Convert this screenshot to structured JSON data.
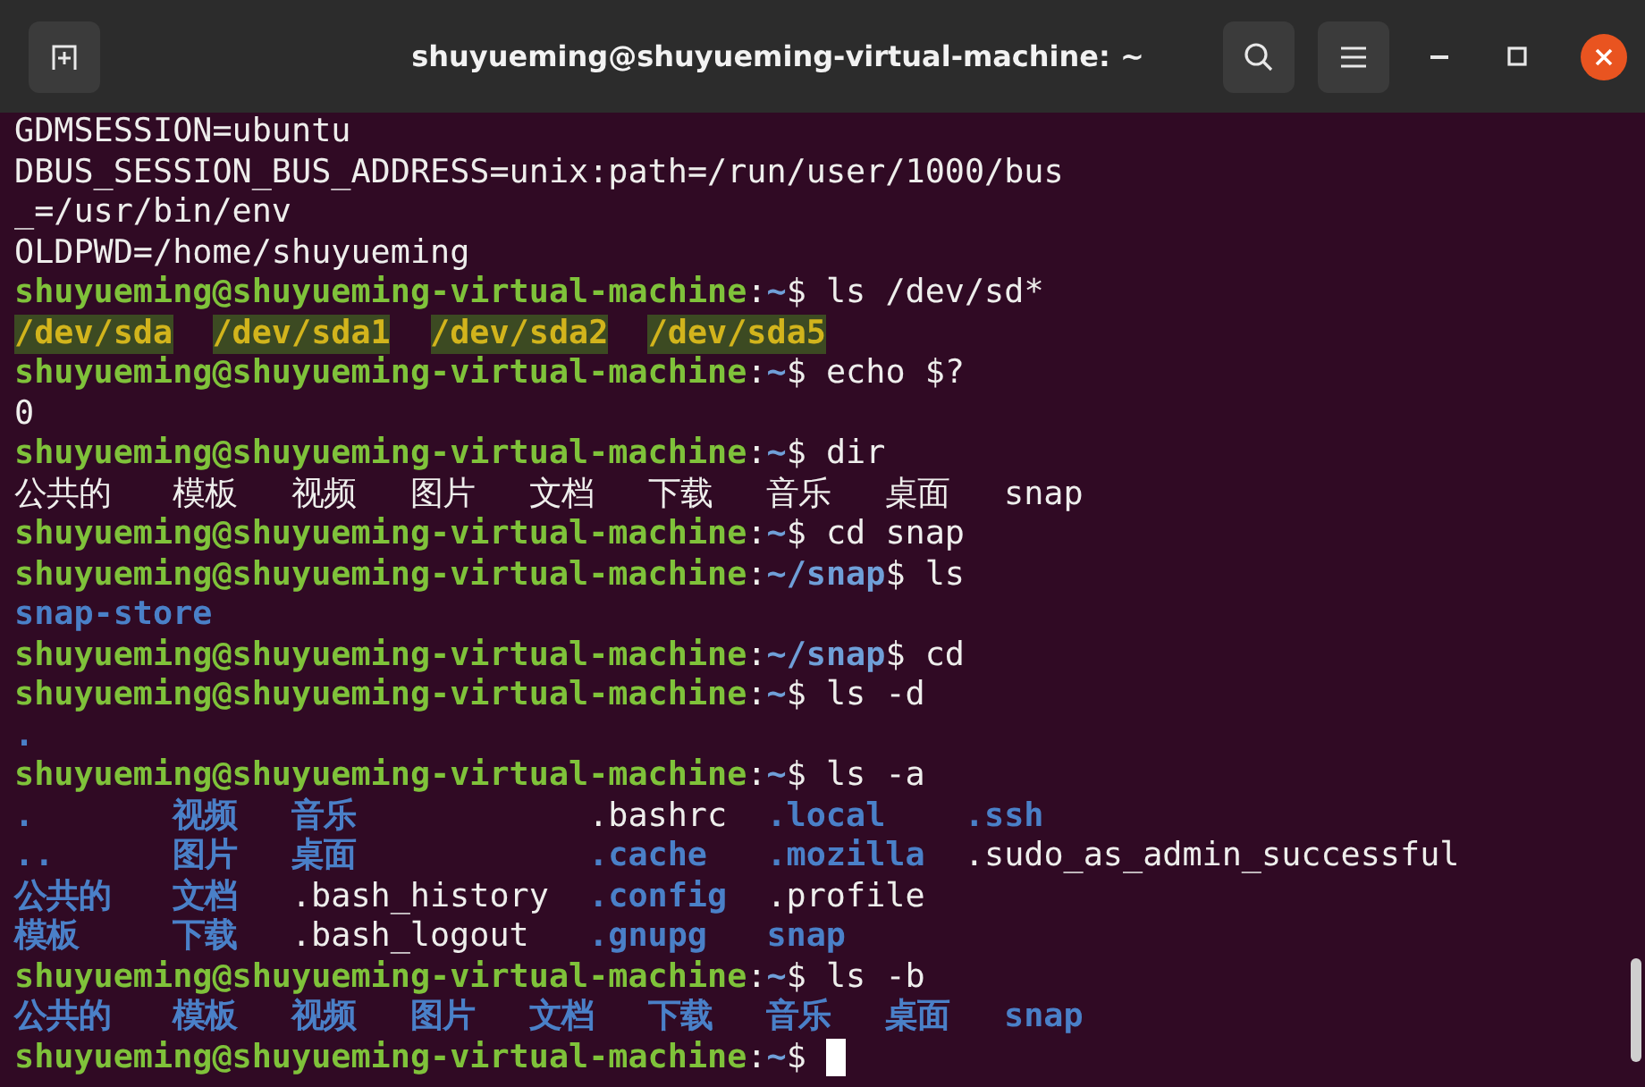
{
  "window": {
    "title": "shuyueming@shuyueming-virtual-machine: ~"
  },
  "terminal": {
    "lines": [
      {
        "kind": "seq",
        "segments": [
          {
            "text": "GDMSESSION=ubuntu",
            "kind": "plain"
          }
        ]
      },
      {
        "kind": "seq",
        "segments": [
          {
            "text": "DBUS_SESSION_BUS_ADDRESS=unix:path=/run/user/1000/bus",
            "kind": "plain"
          }
        ]
      },
      {
        "kind": "seq",
        "segments": [
          {
            "text": "_=/usr/bin/env",
            "kind": "plain"
          }
        ]
      },
      {
        "kind": "seq",
        "segments": [
          {
            "text": "OLDPWD=/home/shuyueming",
            "kind": "plain"
          }
        ]
      },
      {
        "kind": "seq",
        "segments": [
          {
            "text": "shuyueming@shuyueming-virtual-machine",
            "kind": "user"
          },
          {
            "text": ":",
            "kind": "plain"
          },
          {
            "text": "~",
            "kind": "path"
          },
          {
            "text": "$ ls /dev/sd*",
            "kind": "plain"
          }
        ]
      },
      {
        "kind": "list",
        "items": [
          {
            "text": "/dev/sda",
            "kind": "device"
          },
          {
            "text": "/dev/sda1",
            "kind": "device"
          },
          {
            "text": "/dev/sda2",
            "kind": "device"
          },
          {
            "text": "/dev/sda5",
            "kind": "device"
          }
        ]
      },
      {
        "kind": "seq",
        "segments": [
          {
            "text": "shuyueming@shuyueming-virtual-machine",
            "kind": "user"
          },
          {
            "text": ":",
            "kind": "plain"
          },
          {
            "text": "~",
            "kind": "path"
          },
          {
            "text": "$ echo $?",
            "kind": "plain"
          }
        ]
      },
      {
        "kind": "seq",
        "segments": [
          {
            "text": "0",
            "kind": "plain"
          }
        ]
      },
      {
        "kind": "seq",
        "segments": [
          {
            "text": "shuyueming@shuyueming-virtual-machine",
            "kind": "user"
          },
          {
            "text": ":",
            "kind": "plain"
          },
          {
            "text": "~",
            "kind": "path"
          },
          {
            "text": "$ dir",
            "kind": "plain"
          }
        ]
      },
      {
        "kind": "list",
        "items": [
          {
            "text": "公共的",
            "kind": "plain"
          },
          {
            "text": "模板",
            "kind": "plain"
          },
          {
            "text": "视频",
            "kind": "plain"
          },
          {
            "text": "图片",
            "kind": "plain"
          },
          {
            "text": "文档",
            "kind": "plain"
          },
          {
            "text": "下载",
            "kind": "plain"
          },
          {
            "text": "音乐",
            "kind": "plain"
          },
          {
            "text": "桌面",
            "kind": "plain"
          },
          {
            "text": "snap",
            "kind": "plain"
          }
        ]
      },
      {
        "kind": "seq",
        "segments": [
          {
            "text": "shuyueming@shuyueming-virtual-machine",
            "kind": "user"
          },
          {
            "text": ":",
            "kind": "plain"
          },
          {
            "text": "~",
            "kind": "path"
          },
          {
            "text": "$ cd snap",
            "kind": "plain"
          }
        ]
      },
      {
        "kind": "seq",
        "segments": [
          {
            "text": "shuyueming@shuyueming-virtual-machine",
            "kind": "user"
          },
          {
            "text": ":",
            "kind": "plain"
          },
          {
            "text": "~/snap",
            "kind": "path"
          },
          {
            "text": "$ ls",
            "kind": "plain"
          }
        ]
      },
      {
        "kind": "list",
        "items": [
          {
            "text": "snap-store",
            "kind": "dir"
          }
        ]
      },
      {
        "kind": "seq",
        "segments": [
          {
            "text": "shuyueming@shuyueming-virtual-machine",
            "kind": "user"
          },
          {
            "text": ":",
            "kind": "plain"
          },
          {
            "text": "~/snap",
            "kind": "path"
          },
          {
            "text": "$ cd",
            "kind": "plain"
          }
        ]
      },
      {
        "kind": "seq",
        "segments": [
          {
            "text": "shuyueming@shuyueming-virtual-machine",
            "kind": "user"
          },
          {
            "text": ":",
            "kind": "plain"
          },
          {
            "text": "~",
            "kind": "path"
          },
          {
            "text": "$ ls -d",
            "kind": "plain"
          }
        ]
      },
      {
        "kind": "list",
        "items": [
          {
            "text": ".",
            "kind": "dir"
          }
        ]
      },
      {
        "kind": "seq",
        "segments": [
          {
            "text": "shuyueming@shuyueming-virtual-machine",
            "kind": "user"
          },
          {
            "text": ":",
            "kind": "plain"
          },
          {
            "text": "~",
            "kind": "path"
          },
          {
            "text": "$ ls -a",
            "kind": "plain"
          }
        ]
      },
      {
        "kind": "grid",
        "rows": [
          [
            {
              "text": ".",
              "kind": "dir"
            },
            {
              "text": "视频",
              "kind": "dir"
            },
            {
              "text": "音乐",
              "kind": "dir"
            },
            {
              "text": ".bashrc",
              "kind": "plain"
            },
            {
              "text": ".local",
              "kind": "dir"
            },
            {
              "text": ".ssh",
              "kind": "dir"
            }
          ],
          [
            {
              "text": "..",
              "kind": "dir"
            },
            {
              "text": "图片",
              "kind": "dir"
            },
            {
              "text": "桌面",
              "kind": "dir"
            },
            {
              "text": ".cache",
              "kind": "dir"
            },
            {
              "text": ".mozilla",
              "kind": "dir"
            },
            {
              "text": ".sudo_as_admin_successful",
              "kind": "plain"
            }
          ],
          [
            {
              "text": "公共的",
              "kind": "dir"
            },
            {
              "text": "文档",
              "kind": "dir"
            },
            {
              "text": ".bash_history",
              "kind": "plain"
            },
            {
              "text": ".config",
              "kind": "dir"
            },
            {
              "text": ".profile",
              "kind": "plain"
            }
          ],
          [
            {
              "text": "模板",
              "kind": "dir"
            },
            {
              "text": "下载",
              "kind": "dir"
            },
            {
              "text": ".bash_logout",
              "kind": "plain"
            },
            {
              "text": ".gnupg",
              "kind": "dir"
            },
            {
              "text": "snap",
              "kind": "dir"
            }
          ]
        ]
      },
      {
        "kind": "seq",
        "segments": [
          {
            "text": "shuyueming@shuyueming-virtual-machine",
            "kind": "user"
          },
          {
            "text": ":",
            "kind": "plain"
          },
          {
            "text": "~",
            "kind": "path"
          },
          {
            "text": "$ ls -b",
            "kind": "plain"
          }
        ]
      },
      {
        "kind": "list",
        "items": [
          {
            "text": "公共的",
            "kind": "dir"
          },
          {
            "text": "模板",
            "kind": "dir"
          },
          {
            "text": "视频",
            "kind": "dir"
          },
          {
            "text": "图片",
            "kind": "dir"
          },
          {
            "text": "文档",
            "kind": "dir"
          },
          {
            "text": "下载",
            "kind": "dir"
          },
          {
            "text": "音乐",
            "kind": "dir"
          },
          {
            "text": "桌面",
            "kind": "dir"
          },
          {
            "text": "snap",
            "kind": "dir"
          }
        ]
      },
      {
        "kind": "seq",
        "cursor": true,
        "segments": [
          {
            "text": "shuyueming@shuyueming-virtual-machine",
            "kind": "user"
          },
          {
            "text": ":",
            "kind": "plain"
          },
          {
            "text": "~",
            "kind": "path"
          },
          {
            "text": "$",
            "kind": "plain"
          }
        ]
      }
    ]
  }
}
